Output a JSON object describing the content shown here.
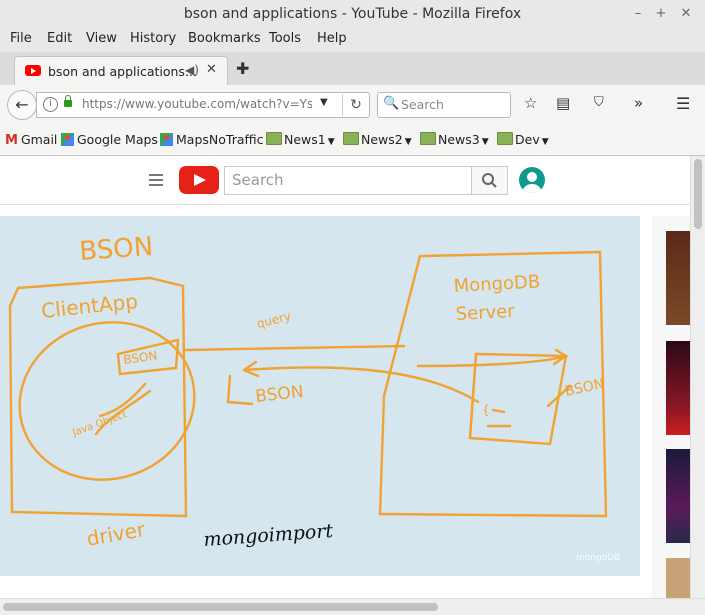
{
  "window": {
    "title": "bson and applications - YouTube - Mozilla Firefox"
  },
  "menu": [
    "File",
    "Edit",
    "View",
    "History",
    "Bookmarks",
    "Tools",
    "Help"
  ],
  "tab": {
    "label": "bson and applications..."
  },
  "nav": {
    "url": "https://www.youtube.com/watch?v=YsfwT",
    "search_placeholder": "Search"
  },
  "bookmarks": [
    {
      "label": "Gmail",
      "icon": "gmail-icon"
    },
    {
      "label": "Google Maps",
      "icon": "maps-icon"
    },
    {
      "label": "MapsNoTraffic",
      "icon": "maps-icon"
    },
    {
      "label": "News1",
      "icon": "folder-icon",
      "folder": true
    },
    {
      "label": "News2",
      "icon": "folder-icon",
      "folder": true
    },
    {
      "label": "News3",
      "icon": "folder-icon",
      "folder": true
    },
    {
      "label": "Dev",
      "icon": "folder-icon",
      "folder": true
    }
  ],
  "youtube": {
    "search_placeholder": "Search",
    "brand_color": "#e62117"
  },
  "video": {
    "whiteboard": {
      "heading": "BSON",
      "client_app": "ClientApp",
      "bson_label": "BSON",
      "java_object": "Java Object",
      "driver": "driver",
      "query": "query",
      "bson_transfer": "BSON",
      "server_line1": "MongoDB",
      "server_line2": "Server",
      "bson_right": "BSON",
      "mongoimport": "mongoimport",
      "watermark": "mongoDB"
    }
  }
}
